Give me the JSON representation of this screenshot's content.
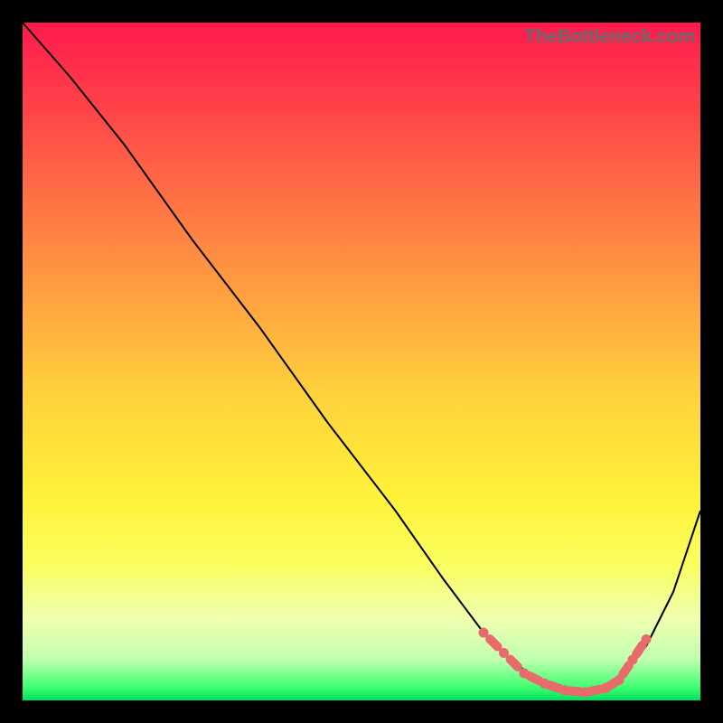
{
  "watermark": "TheBottleneck.com",
  "chart_data": {
    "type": "line",
    "title": "",
    "xlabel": "",
    "ylabel": "",
    "xlim": [
      0,
      100
    ],
    "ylim": [
      0,
      100
    ],
    "series": [
      {
        "name": "bottleneck-curve",
        "x": [
          0,
          7,
          15,
          25,
          35,
          45,
          55,
          62,
          68,
          72,
          76,
          80,
          84,
          88,
          92,
          96,
          100
        ],
        "y": [
          100,
          92,
          82,
          68,
          55,
          41,
          28,
          18,
          10,
          6,
          3,
          1,
          1,
          3,
          8,
          16,
          28
        ]
      }
    ],
    "marker_points": {
      "name": "highlighted-range",
      "x": [
        68,
        71,
        74,
        77,
        80,
        83,
        86,
        88,
        90,
        92
      ],
      "y": [
        10,
        7,
        4,
        2.5,
        1.5,
        1.2,
        1.8,
        3,
        6,
        9
      ]
    }
  }
}
